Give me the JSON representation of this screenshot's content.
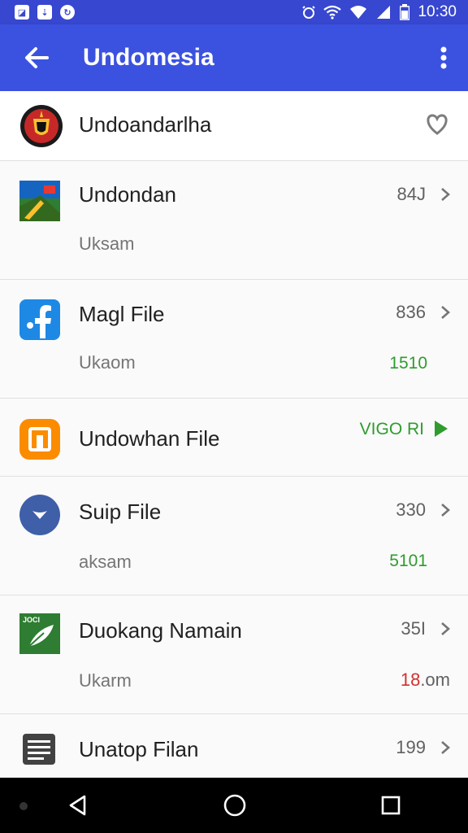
{
  "status_bar": {
    "left_icons": [
      "image-icon",
      "download-icon",
      "sync-icon"
    ],
    "time": "10:30"
  },
  "app_bar": {
    "title": "Undomesia"
  },
  "items": [
    {
      "title": "Undoandarlha",
      "icon": "emblem-icon",
      "trailing_icon": "heart-icon"
    },
    {
      "title": "Undondan",
      "subtitle": "Uksam",
      "count": "84J"
    },
    {
      "title": "Magl File",
      "subtitle": "Ukaom",
      "count": "836",
      "value": "1510",
      "value_color": "#2e9c2e"
    },
    {
      "title": "Undowhan Filе",
      "action_label": "VIGO RI",
      "action_color": "#2e9c2e"
    },
    {
      "title": "Suip File",
      "subtitle": "aksam",
      "count": "330",
      "value": "5101",
      "value_color": "#2e9c2e"
    },
    {
      "title": "Duokang Namain",
      "subtitle": "Ukarm",
      "count": "35I",
      "value_prefix": "18",
      "value_suffix": ".om",
      "value_prefix_color": "#d32f2f",
      "icon_text": "JOCI"
    },
    {
      "title": "Unatop Filan",
      "count": "199"
    }
  ],
  "colors": {
    "accent": "#3b52e0",
    "statusbar": "#3747cf",
    "green": "#2e9c2e",
    "red": "#d32f2f"
  }
}
